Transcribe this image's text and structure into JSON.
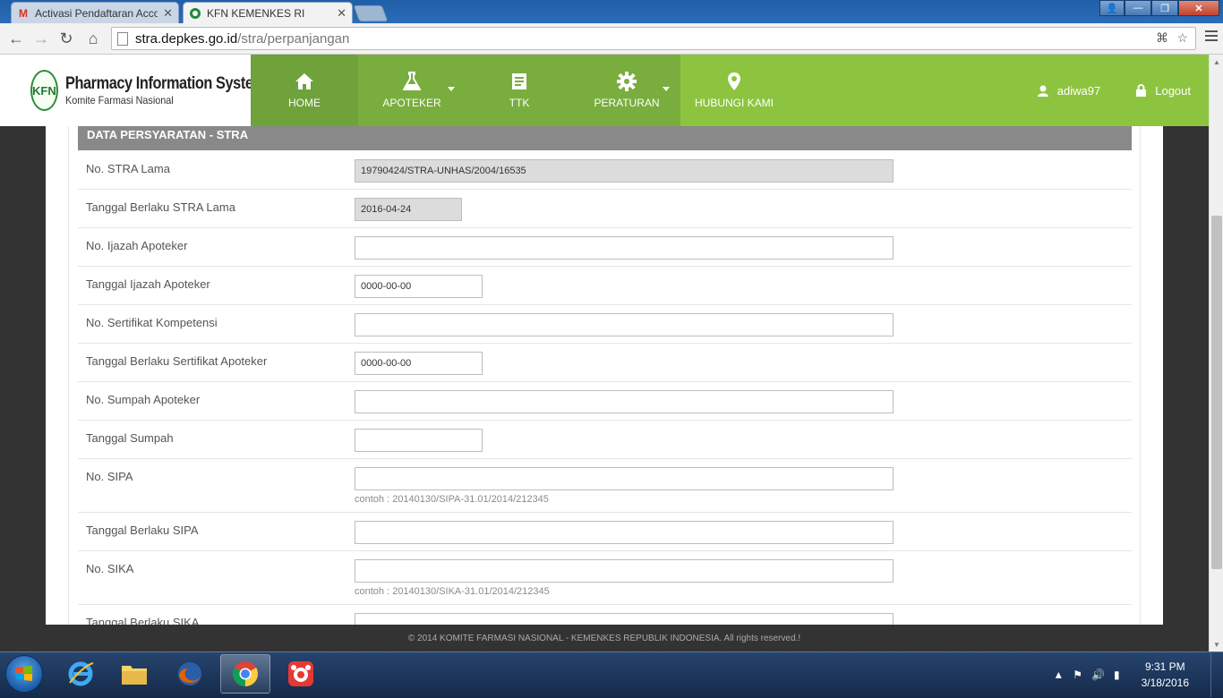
{
  "browser": {
    "tabs": [
      {
        "title": "Activasi Pendaftaran Acco",
        "favicon": "gmail-icon",
        "active": false
      },
      {
        "title": "KFN KEMENKES RI",
        "favicon": "kfn-icon",
        "active": true
      }
    ],
    "url_host": "stra.depkes.go.id",
    "url_path": "/stra/perpanjangan"
  },
  "site": {
    "title": "Pharmacy Information System",
    "subtitle": "Komite Farmasi Nasional",
    "logo_text": "KFN",
    "nav": [
      {
        "label": "HOME",
        "icon": "home-icon"
      },
      {
        "label": "APOTEKER",
        "icon": "flask-icon",
        "dropdown": true
      },
      {
        "label": "TTK",
        "icon": "document-icon"
      },
      {
        "label": "PERATURAN",
        "icon": "gear-icon",
        "dropdown": true
      },
      {
        "label": "HUBUNGI KAMI",
        "icon": "map-marker-icon"
      }
    ],
    "username": "adiwa97",
    "logout": "Logout",
    "colors": {
      "accent": "#8cc43f",
      "nav_dark": "#6fa23a",
      "section_head": "#898989"
    }
  },
  "form": {
    "section_title": "DATA PERSYARATAN - STRA",
    "rows": [
      {
        "label": "No. STRA Lama",
        "value": "19790424/STRA-UNHAS/2004/16535",
        "readonly": true
      },
      {
        "label": "Tanggal Berlaku STRA Lama",
        "value": "2016-04-24",
        "readonly": true
      },
      {
        "label": "No. Ijazah Apoteker",
        "value": ""
      },
      {
        "label": "Tanggal Ijazah Apoteker",
        "value": "0000-00-00"
      },
      {
        "label": "No. Sertifikat Kompetensi",
        "value": ""
      },
      {
        "label": "Tanggal Berlaku Sertifikat Apoteker",
        "value": "0000-00-00"
      },
      {
        "label": "No. Sumpah Apoteker",
        "value": ""
      },
      {
        "label": "Tanggal Sumpah",
        "value": ""
      },
      {
        "label": "No. SIPA",
        "value": "",
        "hint": "contoh : 20140130/SIPA-31.01/2014/212345"
      },
      {
        "label": "Tanggal Berlaku SIPA",
        "value": ""
      },
      {
        "label": "No. SIKA",
        "value": "",
        "hint": "contoh : 20140130/SIKA-31.01/2014/212345"
      },
      {
        "label": "Tanggal Berlaku SIKA",
        "value": ""
      }
    ]
  },
  "footer": "© 2014 KOMITE FARMASI NASIONAL - KEMENKES REPUBLIK INDONESIA. All rights reserved.!",
  "taskbar": {
    "apps": [
      "internet-explorer-icon",
      "file-explorer-icon",
      "firefox-icon",
      "chrome-icon",
      "app-icon"
    ],
    "time": "9:31 PM",
    "date": "3/18/2016"
  }
}
